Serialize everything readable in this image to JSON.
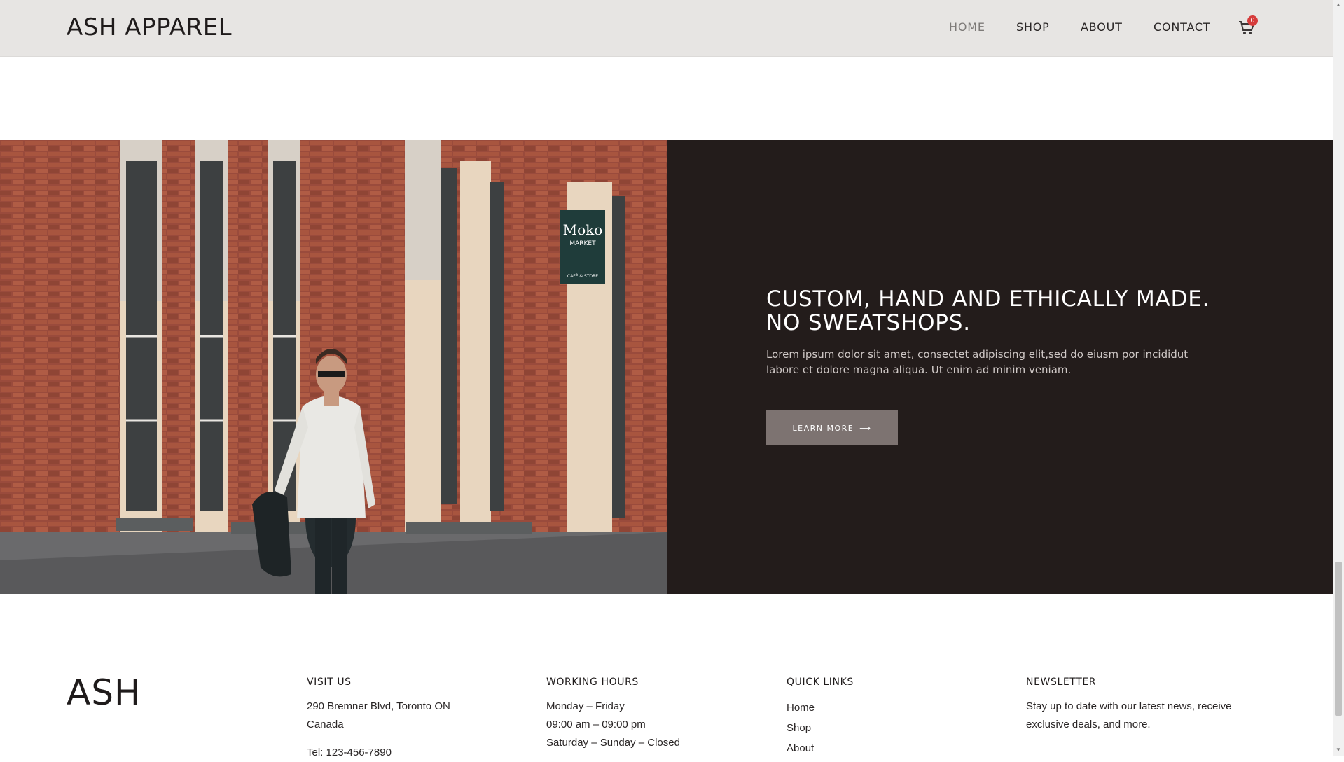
{
  "header": {
    "logo": "ASH APPAREL",
    "nav": [
      "HOME",
      "SHOP",
      "ABOUT",
      "CONTACT"
    ],
    "active_nav": "HOME",
    "cart_count": "0"
  },
  "hero": {
    "title_line1": "CUSTOM, HAND AND ETHICALLY MADE.",
    "title_line2": "NO SWEATSHOPS.",
    "text": "Lorem ipsum dolor sit amet, consectet adipiscing elit,sed do eiusm por incididut labore et dolore magna aliqua. Ut enim ad minim veniam.",
    "button_label": "LEARN MORE",
    "button_icon": "arrow-right-icon",
    "sign_line1": "Moko",
    "sign_line2": "MARKET",
    "sign_line3": "CAFÉ & STORE"
  },
  "footer": {
    "logo": "ASH",
    "visit": {
      "heading": "VISIT US",
      "address_line1": "290 Bremner Blvd, Toronto ON",
      "address_line2": "Canada",
      "tel": "Tel: 123-456-7890"
    },
    "hours": {
      "heading": "WORKING HOURS",
      "line1": "Monday – Friday",
      "line2": "09:00 am – 09:00 pm",
      "line3": "Saturday – Sunday – Closed"
    },
    "links": {
      "heading": "QUICK LINKS",
      "items": [
        "Home",
        "Shop",
        "About"
      ]
    },
    "newsletter": {
      "heading": "NEWSLETTER",
      "text_line1": "Stay up to date with our latest news, receive",
      "text_line2": "exclusive deals, and more."
    }
  },
  "colors": {
    "header_bg": "#e7e5e3",
    "hero_panel_bg": "#231c1b",
    "button_bg": "#7d7371",
    "badge": "#d63b3b"
  }
}
